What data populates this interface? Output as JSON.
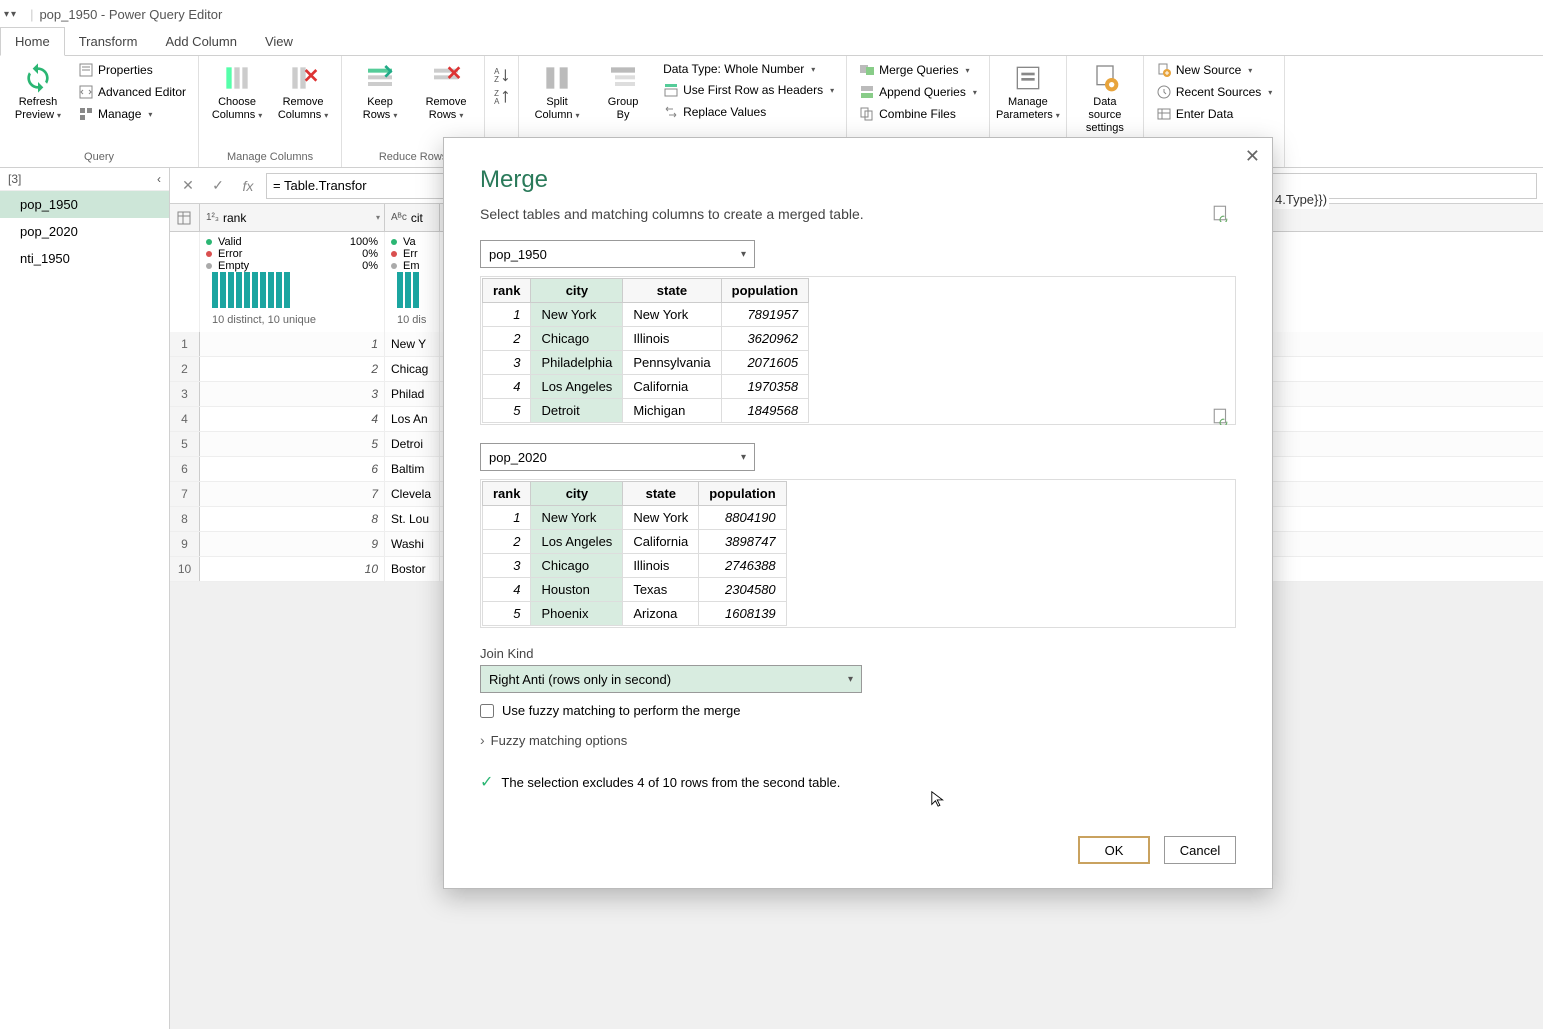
{
  "window": {
    "title": "pop_1950 - Power Query Editor"
  },
  "tabs": {
    "home": "Home",
    "transform": "Transform",
    "add_column": "Add Column",
    "view": "View"
  },
  "ribbon": {
    "refresh_preview": "Refresh\nPreview",
    "properties": "Properties",
    "advanced_editor": "Advanced Editor",
    "manage": "Manage",
    "query_group": "Query",
    "choose_columns": "Choose\nColumns",
    "remove_columns": "Remove\nColumns",
    "manage_columns_group": "Manage Columns",
    "keep_rows": "Keep\nRows",
    "remove_rows": "Remove\nRows",
    "reduce_rows_group": "Reduce Rows",
    "split_column": "Split\nColumn",
    "group_by": "Group\nBy",
    "data_type": "Data Type: Whole Number",
    "use_first_row": "Use First Row as Headers",
    "replace_values": "Replace Values",
    "merge_queries": "Merge Queries",
    "append_queries": "Append Queries",
    "combine_files": "Combine Files",
    "manage_parameters": "Manage\nParameters",
    "data_source_settings": "Data source\nsettings",
    "new_source": "New Source",
    "recent_sources": "Recent Sources",
    "enter_data": "Enter Data"
  },
  "queries": {
    "header": "[3]",
    "items": [
      "pop_1950",
      "pop_2020",
      "nti_1950"
    ],
    "selected_index": 0
  },
  "formula": {
    "text": "= Table.Transfor",
    "suffix": "4.Type}})"
  },
  "grid": {
    "col1": "rank",
    "col2": "cit",
    "quality": {
      "valid": "Valid",
      "valid_pct": "100%",
      "error": "Error",
      "error_pct": "0%",
      "empty": "Empty",
      "empty_pct": "0%"
    },
    "distinct": "10 distinct, 10 unique",
    "distinct2": "10 dis",
    "rows": [
      {
        "n": "1",
        "rank": "1",
        "city": "New Y"
      },
      {
        "n": "2",
        "rank": "2",
        "city": "Chicag"
      },
      {
        "n": "3",
        "rank": "3",
        "city": "Philad"
      },
      {
        "n": "4",
        "rank": "4",
        "city": "Los An"
      },
      {
        "n": "5",
        "rank": "5",
        "city": "Detroi"
      },
      {
        "n": "6",
        "rank": "6",
        "city": "Baltim"
      },
      {
        "n": "7",
        "rank": "7",
        "city": "Clevela"
      },
      {
        "n": "8",
        "rank": "8",
        "city": "St. Lou"
      },
      {
        "n": "9",
        "rank": "9",
        "city": "Washi"
      },
      {
        "n": "10",
        "rank": "10",
        "city": "Bostor"
      }
    ]
  },
  "merge": {
    "title": "Merge",
    "subtitle": "Select tables and matching columns to create a merged table.",
    "table1": "pop_1950",
    "table2": "pop_2020",
    "headers": {
      "rank": "rank",
      "city": "city",
      "state": "state",
      "population": "population"
    },
    "preview1": [
      {
        "rank": "1",
        "city": "New York",
        "state": "New York",
        "pop": "7891957"
      },
      {
        "rank": "2",
        "city": "Chicago",
        "state": "Illinois",
        "pop": "3620962"
      },
      {
        "rank": "3",
        "city": "Philadelphia",
        "state": "Pennsylvania",
        "pop": "2071605"
      },
      {
        "rank": "4",
        "city": "Los Angeles",
        "state": "California",
        "pop": "1970358"
      },
      {
        "rank": "5",
        "city": "Detroit",
        "state": "Michigan",
        "pop": "1849568"
      }
    ],
    "preview2": [
      {
        "rank": "1",
        "city": "New York",
        "state": "New York",
        "pop": "8804190"
      },
      {
        "rank": "2",
        "city": "Los Angeles",
        "state": "California",
        "pop": "3898747"
      },
      {
        "rank": "3",
        "city": "Chicago",
        "state": "Illinois",
        "pop": "2746388"
      },
      {
        "rank": "4",
        "city": "Houston",
        "state": "Texas",
        "pop": "2304580"
      },
      {
        "rank": "5",
        "city": "Phoenix",
        "state": "Arizona",
        "pop": "1608139"
      }
    ],
    "join_kind_label": "Join Kind",
    "join_kind_value": "Right Anti (rows only in second)",
    "fuzzy_check": "Use fuzzy matching to perform the merge",
    "fuzzy_options": "Fuzzy matching options",
    "status": "The selection excludes 4 of 10 rows from the second table.",
    "ok": "OK",
    "cancel": "Cancel"
  }
}
